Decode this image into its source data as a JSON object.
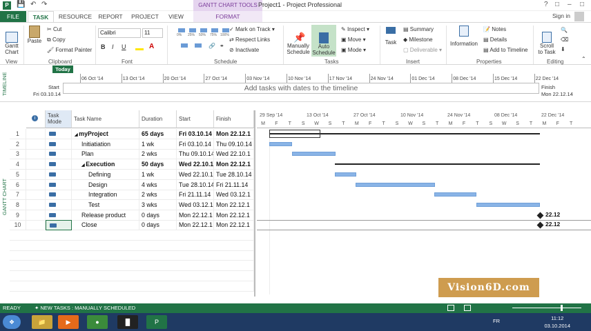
{
  "title": {
    "context_tab": "GANTT CHART TOOLS",
    "window": "Project1 - Project Professional"
  },
  "tabs": [
    "FILE",
    "TASK",
    "RESOURCE",
    "REPORT",
    "PROJECT",
    "VIEW",
    "FORMAT"
  ],
  "signin": "Sign in",
  "ribbon": {
    "view": {
      "gantt": "Gantt\nChart",
      "label": "View"
    },
    "clipboard": {
      "paste": "Paste",
      "cut": "Cut",
      "copy": "Copy",
      "format_painter": "Format Painter",
      "label": "Clipboard"
    },
    "font": {
      "name": "Calibri",
      "size": "11",
      "bold": "B",
      "italic": "I",
      "underline": "U",
      "label": "Font"
    },
    "schedule": {
      "mark_on_track": "Mark on Track",
      "respect_links": "Respect Links",
      "inactivate": "Inactivate",
      "label": "Schedule",
      "pct": [
        "0%",
        "25%",
        "50%",
        "75%",
        "100%"
      ]
    },
    "tasks": {
      "manually": "Manually\nSchedule",
      "auto": "Auto\nSchedule",
      "inspect": "Inspect",
      "move": "Move",
      "mode": "Mode",
      "label": "Tasks"
    },
    "insert": {
      "task": "Task",
      "summary": "Summary",
      "milestone": "Milestone",
      "deliverable": "Deliverable",
      "label": "Insert"
    },
    "properties": {
      "information": "Information",
      "notes": "Notes",
      "details": "Details",
      "add_timeline": "Add to Timeline",
      "label": "Properties"
    },
    "editing": {
      "scroll": "Scroll\nto Task",
      "label": "Editing"
    }
  },
  "timeline": {
    "vertical_label": "TIMELINE",
    "today": "Today",
    "start_label": "Start",
    "start_date": "Fri 03.10.14",
    "finish_label": "Finish",
    "finish_date": "Mon 22.12.14",
    "placeholder": "Add tasks with dates to the timeline",
    "dates": [
      "06 Oct '14",
      "13 Oct '14",
      "20 Oct '14",
      "27 Oct '14",
      "03 Nov '14",
      "10 Nov '14",
      "17 Nov '14",
      "24 Nov '14",
      "01 Dec '14",
      "08 Dec '14",
      "15 Dec '14",
      "22 Dec '14"
    ]
  },
  "sheet": {
    "vertical_label": "GANTT CHART",
    "headers": {
      "mode": "Task\nMode",
      "name": "Task Name",
      "duration": "Duration",
      "start": "Start",
      "finish": "Finish"
    },
    "rows": [
      {
        "id": "1",
        "name": "myProject",
        "duration": "65 days",
        "start": "Fri 03.10.14",
        "finish": "Mon 22.12.1"
      },
      {
        "id": "2",
        "name": "Initiatiation",
        "duration": "1 wk",
        "start": "Fri 03.10.14",
        "finish": "Thu 09.10.14"
      },
      {
        "id": "3",
        "name": "Plan",
        "duration": "2 wks",
        "start": "Thu 09.10.14",
        "finish": "Wed 22.10.1"
      },
      {
        "id": "4",
        "name": "Execution",
        "duration": "50 days",
        "start": "Wed 22.10.1",
        "finish": "Mon 22.12.1"
      },
      {
        "id": "5",
        "name": "Defining",
        "duration": "1 wk",
        "start": "Wed 22.10.1",
        "finish": "Tue 28.10.14"
      },
      {
        "id": "6",
        "name": "Design",
        "duration": "4 wks",
        "start": "Tue 28.10.14",
        "finish": "Fri 21.11.14"
      },
      {
        "id": "7",
        "name": "Integration",
        "duration": "2 wks",
        "start": "Fri 21.11.14",
        "finish": "Wed 03.12.1"
      },
      {
        "id": "8",
        "name": "Test",
        "duration": "3 wks",
        "start": "Wed 03.12.14",
        "finish": "Mon 22.12.1"
      },
      {
        "id": "9",
        "name": "Release product",
        "duration": "0 days",
        "start": "Mon 22.12.1",
        "finish": "Mon 22.12.1"
      },
      {
        "id": "10",
        "name": "Close",
        "duration": "0 days",
        "start": "Mon 22.12.1",
        "finish": "Mon 22.12.1"
      }
    ]
  },
  "chart": {
    "weeks": [
      "29 Sep '14",
      "13 Oct '14",
      "27 Oct '14",
      "10 Nov '14",
      "24 Nov '14",
      "08 Dec '14",
      "22 Dec '14"
    ],
    "days": [
      "M",
      "F",
      "T",
      "S",
      "W",
      "S",
      "T",
      "M",
      "F",
      "T",
      "S",
      "W",
      "S",
      "T",
      "M",
      "F",
      "T",
      "S",
      "W",
      "S",
      "T",
      "M",
      "F",
      "T"
    ],
    "milestone_labels": [
      "22.12",
      "22.12"
    ]
  },
  "watermark": "Vision6D.com",
  "status": {
    "ready": "READY",
    "new_tasks": "NEW TASKS : MANUALLY SCHEDULED"
  },
  "taskbar": {
    "lang": "FR",
    "time": "11:12",
    "date": "03.10.2014"
  }
}
